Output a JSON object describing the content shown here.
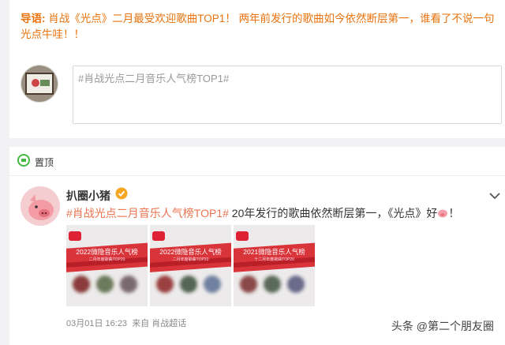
{
  "intro": {
    "label": "导语:",
    "text": "肖战《光点》二月最受欢迎歌曲TOP1！ 两年前发行的歌曲如今依然断层第一，谁看了不说一句光点牛哇！！"
  },
  "composer": {
    "text": "#肖战光点二月音乐人气榜TOP1#"
  },
  "feed": {
    "pin_label": "置顶",
    "post": {
      "username": "扒圈小猪",
      "verified_icon": "verified-badge-icon",
      "hashtag": "#肖战光点二月音乐人气榜TOP1#",
      "text": " 20年发行的歌曲依然断层第一，《光点》好",
      "emoji": "pig-emoji-icon",
      "text_end": "！",
      "images": [
        {
          "title": "2022微隐音乐人气榜",
          "subtitle": "二月年度歌曲TOP20"
        },
        {
          "title": "2022微隐音乐人气榜",
          "subtitle": "二月年度歌曲TOP20"
        },
        {
          "title": "2021微隐音乐人气榜",
          "subtitle": "十二月年度歌曲TOP20"
        }
      ],
      "date": "03月01日 16:23",
      "source": "来自 肖战超话"
    }
  },
  "watermark": "头条 @第二个朋友圈",
  "colors": {
    "accent": "#e8720c",
    "hashtag": "#eb7350",
    "ribbon": "#d9343a"
  }
}
